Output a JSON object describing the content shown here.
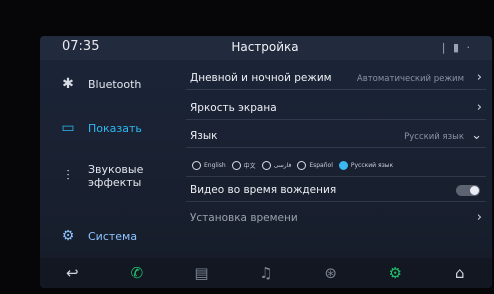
{
  "header": {
    "clock": "07:35",
    "title": "Настройка",
    "status": "| ▮ ·"
  },
  "sidebar": {
    "items": [
      {
        "label": "Bluetooth",
        "icon": "bluetooth-icon",
        "glyph": "✱"
      },
      {
        "label": "Показать",
        "icon": "display-icon",
        "glyph": "▭"
      },
      {
        "label": "Звуковые эффекты",
        "icon": "equalizer-icon",
        "glyph": "⫶"
      },
      {
        "label": "Система",
        "icon": "gear-icon",
        "glyph": "⚙"
      }
    ]
  },
  "settings": {
    "day_night": {
      "label": "Дневной и ночной режим",
      "value": "Автоматический режим"
    },
    "brightness": {
      "label": "Яркость экрана"
    },
    "language": {
      "label": "Язык",
      "value": "Русский язык"
    },
    "language_options": [
      "English",
      "中文",
      "فارسی",
      "Español",
      "Русский язык"
    ],
    "video_driving": {
      "label": "Видео во время вождения"
    },
    "time_setting": {
      "label": "Установка времени"
    }
  },
  "navbar": {
    "items": [
      {
        "icon": "back-icon",
        "glyph": "↩"
      },
      {
        "icon": "phone-icon",
        "glyph": "✆"
      },
      {
        "icon": "radio-icon",
        "glyph": "▤"
      },
      {
        "icon": "music-icon",
        "glyph": "♫"
      },
      {
        "icon": "steering-wheel-icon",
        "glyph": "⊛"
      },
      {
        "icon": "settings-gear-icon",
        "glyph": "⚙"
      },
      {
        "icon": "home-icon",
        "glyph": "⌂"
      }
    ]
  },
  "colors": {
    "accent": "#2fb8f2",
    "active_green": "#21c16b"
  }
}
